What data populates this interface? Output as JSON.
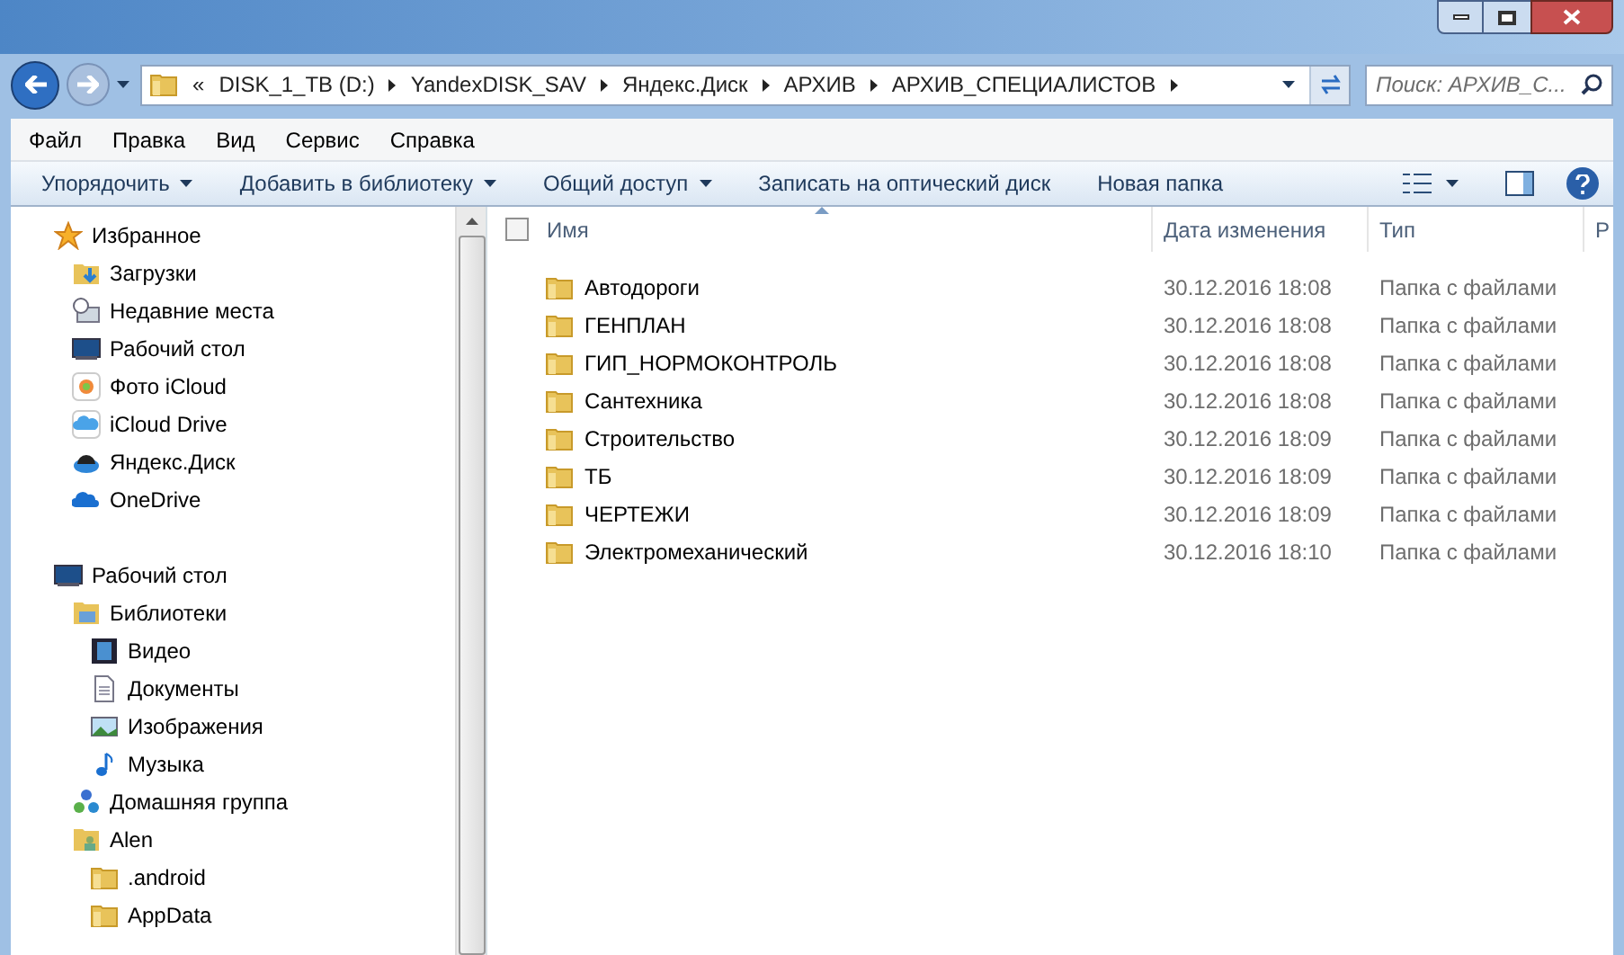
{
  "address": {
    "back": "«",
    "crumbs": [
      "DISK_1_TB (D:)",
      "YandexDISK_SAV",
      "Яндекс.Диск",
      "АРХИВ",
      "АРХИВ_СПЕЦИАЛИСТОВ"
    ]
  },
  "search": {
    "placeholder": "Поиск: АРХИВ_С..."
  },
  "menu": [
    "Файл",
    "Правка",
    "Вид",
    "Сервис",
    "Справка"
  ],
  "toolbar": [
    {
      "label": "Упорядочить",
      "dropdown": true
    },
    {
      "label": "Добавить в библиотеку",
      "dropdown": true
    },
    {
      "label": "Общий доступ",
      "dropdown": true
    },
    {
      "label": "Записать на оптический диск",
      "dropdown": false
    },
    {
      "label": "Новая папка",
      "dropdown": false
    }
  ],
  "sidebar": [
    {
      "label": "Избранное",
      "kind": "star",
      "children": [
        {
          "label": "Загрузки",
          "kind": "download"
        },
        {
          "label": "Недавние места",
          "kind": "recent"
        },
        {
          "label": "Рабочий стол",
          "kind": "desktop"
        },
        {
          "label": "Фото iCloud",
          "kind": "photos"
        },
        {
          "label": "iCloud Drive",
          "kind": "cloud"
        },
        {
          "label": "Яндекс.Диск",
          "kind": "disk"
        },
        {
          "label": "OneDrive",
          "kind": "onedrive"
        }
      ]
    },
    {
      "label": "Рабочий стол",
      "kind": "desktop",
      "children": [
        {
          "label": "Библиотеки",
          "kind": "library",
          "children": [
            {
              "label": "Видео",
              "kind": "video"
            },
            {
              "label": "Документы",
              "kind": "document"
            },
            {
              "label": "Изображения",
              "kind": "image"
            },
            {
              "label": "Музыка",
              "kind": "music"
            }
          ]
        },
        {
          "label": "Домашняя группа",
          "kind": "homegroup"
        },
        {
          "label": "Alen",
          "kind": "user",
          "children": [
            {
              "label": ".android",
              "kind": "folder"
            },
            {
              "label": "AppData",
              "kind": "folder"
            }
          ]
        }
      ]
    }
  ],
  "table": {
    "select_all": {
      "checked": false
    },
    "columns": [
      "Имя",
      "Дата изменения",
      "Тип",
      "Р"
    ],
    "rows": [
      {
        "name": "Автодороги",
        "date": "30.12.2016 18:08",
        "type": "Папка с файлами"
      },
      {
        "name": "ГЕНПЛАН",
        "date": "30.12.2016 18:08",
        "type": "Папка с файлами"
      },
      {
        "name": "ГИП_НОРМОКОНТРОЛЬ",
        "date": "30.12.2016 18:08",
        "type": "Папка с файлами"
      },
      {
        "name": "Сантехника",
        "date": "30.12.2016 18:08",
        "type": "Папка с файлами"
      },
      {
        "name": "Строительство",
        "date": "30.12.2016 18:09",
        "type": "Папка с файлами"
      },
      {
        "name": "ТБ",
        "date": "30.12.2016 18:09",
        "type": "Папка с файлами"
      },
      {
        "name": "ЧЕРТЕЖИ",
        "date": "30.12.2016 18:09",
        "type": "Папка с файлами"
      },
      {
        "name": "Электромеханический",
        "date": "30.12.2016 18:10",
        "type": "Папка с файлами"
      }
    ]
  }
}
